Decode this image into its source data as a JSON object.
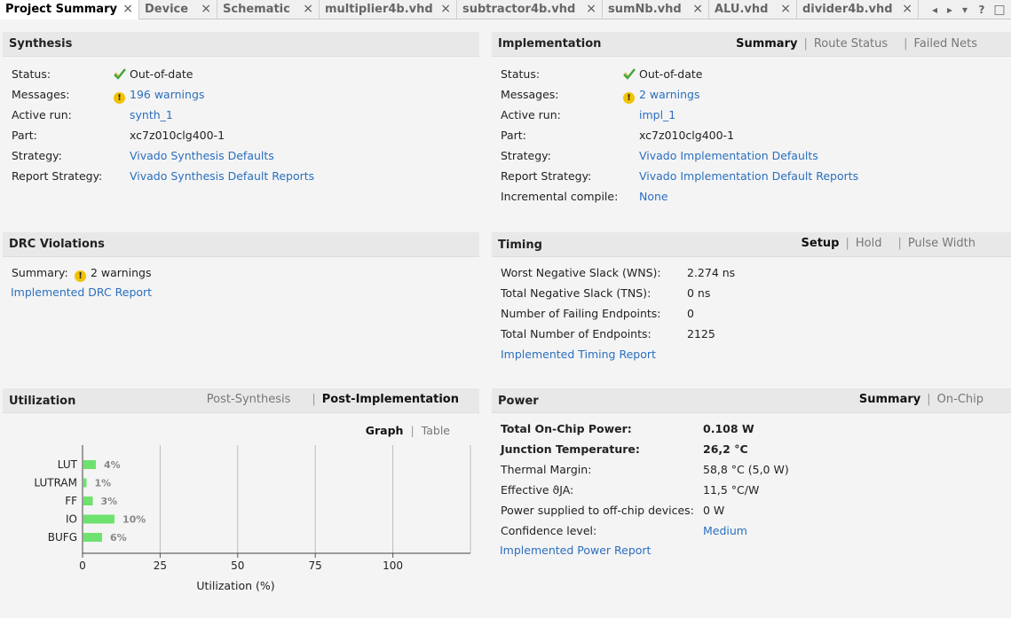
{
  "tabs": [
    {
      "label": "Project Summary",
      "active": true
    },
    {
      "label": "Device",
      "active": false
    },
    {
      "label": "Schematic",
      "active": false
    },
    {
      "label": "multiplier4b.vhd",
      "active": false
    },
    {
      "label": "subtractor4b.vhd",
      "active": false
    },
    {
      "label": "sumNb.vhd",
      "active": false
    },
    {
      "label": "ALU.vhd",
      "active": false
    },
    {
      "label": "divider4b.vhd",
      "active": false
    }
  ],
  "tab_close": "×",
  "tab_controls": {
    "prev": "◂",
    "next": "▸",
    "list": "▾",
    "help": "?",
    "maximize": "□"
  },
  "synthesis": {
    "title": "Synthesis",
    "rows": [
      {
        "label": "Status:",
        "value": "Out-of-date",
        "icon": "check-icon",
        "link": false
      },
      {
        "label": "Messages:",
        "value": "196 warnings",
        "icon": "warning-icon",
        "link": true
      },
      {
        "label": "Active run:",
        "value": "synth_1",
        "link": true
      },
      {
        "label": "Part:",
        "value": "xc7z010clg400-1",
        "link": false
      },
      {
        "label": "Strategy:",
        "value": "Vivado Synthesis Defaults",
        "link": true
      },
      {
        "label": "Report Strategy:",
        "value": "Vivado Synthesis Default Reports",
        "link": true
      }
    ]
  },
  "implementation": {
    "title": "Implementation",
    "links": [
      "Summary",
      "Route Status",
      "Failed Nets"
    ],
    "selected": "Summary",
    "rows": [
      {
        "label": "Status:",
        "value": "Out-of-date",
        "icon": "check-icon",
        "link": false
      },
      {
        "label": "Messages:",
        "value": "2 warnings",
        "icon": "warning-icon",
        "link": true
      },
      {
        "label": "Active run:",
        "value": "impl_1",
        "link": true
      },
      {
        "label": "Part:",
        "value": "xc7z010clg400-1",
        "link": false
      },
      {
        "label": "Strategy:",
        "value": "Vivado Implementation Defaults",
        "link": true
      },
      {
        "label": "Report Strategy:",
        "value": "Vivado Implementation Default Reports",
        "link": true
      },
      {
        "label": "Incremental compile:",
        "value": "None",
        "link": true
      }
    ]
  },
  "drc": {
    "title": "DRC Violations",
    "summary_label": "Summary:",
    "summary_value": "2 warnings",
    "report_link": "Implemented DRC Report"
  },
  "timing": {
    "title": "Timing",
    "links": [
      "Setup",
      "Hold",
      "Pulse Width"
    ],
    "selected": "Setup",
    "rows": [
      {
        "label": "Worst Negative Slack (WNS):",
        "value": "2.274 ns"
      },
      {
        "label": "Total Negative Slack (TNS):",
        "value": "0 ns"
      },
      {
        "label": "Number of Failing Endpoints:",
        "value": "0"
      },
      {
        "label": "Total Number of Endpoints:",
        "value": "2125"
      }
    ],
    "report_link": "Implemented Timing Report"
  },
  "utilization": {
    "title": "Utilization",
    "links": [
      "Post-Synthesis",
      "Post-Implementation"
    ],
    "selected": "Post-Implementation",
    "view_links": [
      "Graph",
      "Table"
    ],
    "view_selected": "Graph"
  },
  "power": {
    "title": "Power",
    "links": [
      "Summary",
      "On-Chip"
    ],
    "selected": "Summary",
    "rows": [
      {
        "label": "Total On-Chip Power:",
        "value": "0.108 W",
        "bold": true
      },
      {
        "label": "Junction Temperature:",
        "value": "26,2 °C",
        "bold": true
      },
      {
        "label": "Thermal Margin:",
        "value": "58,8 °C (5,0 W)"
      },
      {
        "label": "Effective ϑJA:",
        "value": "11,5 °C/W"
      },
      {
        "label": "Power supplied to off-chip devices:",
        "value": "0 W"
      },
      {
        "label": "Confidence level:",
        "value": "Medium",
        "link": true
      }
    ],
    "report_link": "Implemented Power Report"
  },
  "chart_data": {
    "type": "bar",
    "orientation": "horizontal",
    "categories": [
      "LUT",
      "LUTRAM",
      "FF",
      "IO",
      "BUFG"
    ],
    "values": [
      4,
      1,
      3,
      10,
      6
    ],
    "value_labels": [
      "4%",
      "1%",
      "3%",
      "10%",
      "6%"
    ],
    "xlabel": "Utilization (%)",
    "xlim": [
      0,
      125
    ],
    "xticks": [
      0,
      25,
      50,
      75,
      100
    ],
    "grid": true,
    "bar_color": "#6ee26e"
  }
}
